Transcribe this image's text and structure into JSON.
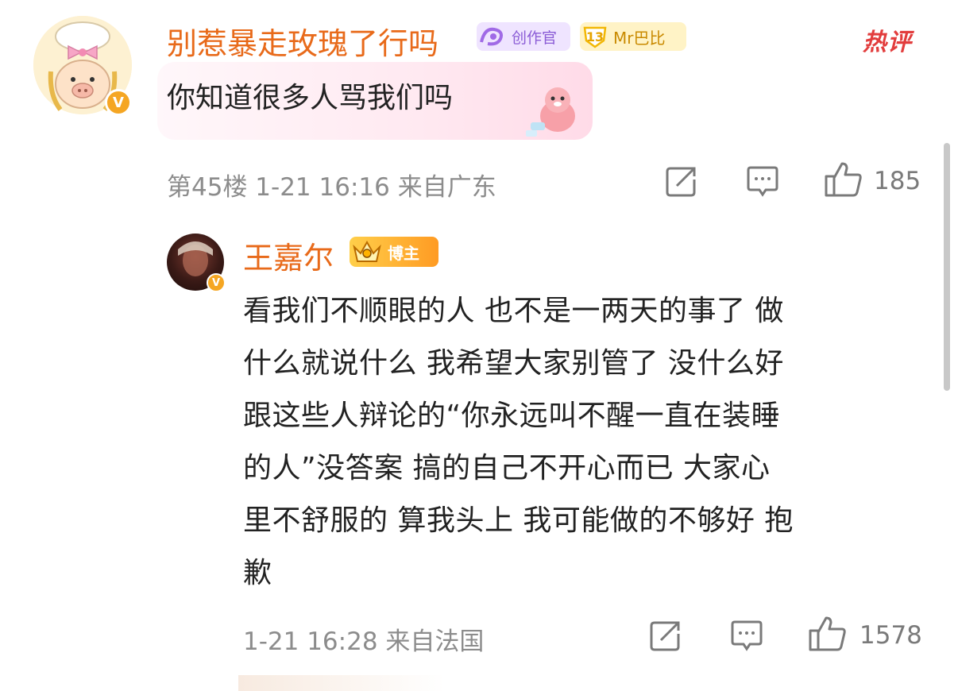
{
  "comment": {
    "username": "别惹暴走玫瑰了行吗",
    "badges": {
      "creator": "创作官",
      "fan_level": "13",
      "fan_name": "Mr巴比"
    },
    "hot_label": "热评",
    "text": "你知道很多人骂我们吗",
    "meta": "第45楼 1-21 16:16 来自广东",
    "like_count": "185",
    "verified_mark": "V"
  },
  "reply": {
    "username": "王嘉尔",
    "badge": "博主",
    "lines": [
      "看我们不顺眼的人 也不是一两天的事了 做",
      "什么就说什么 我希望大家别管了 没什么好",
      "跟这些人辩论的“你永远叫不醒一直在装睡",
      "的人”没答案 搞的自己不开心而已 大家心",
      "里不舒服的 算我头上 我可能做的不够好 抱",
      "歉"
    ],
    "meta": "1-21 16:28 来自法国",
    "like_count": "1578",
    "verified_mark": "V"
  },
  "colors": {
    "username": "#e86a1a",
    "meta": "#8c8c8c",
    "hot": "#e23d3d",
    "verified": "#f5a623"
  }
}
